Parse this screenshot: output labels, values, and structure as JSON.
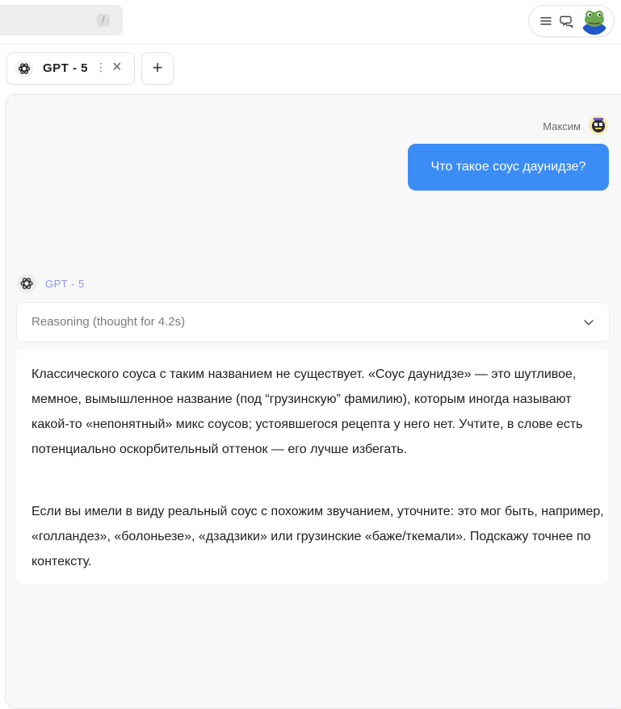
{
  "search": {
    "shortcut": "/"
  },
  "tab": {
    "title": "GPT - 5",
    "more": "⋮",
    "close": "×"
  },
  "add_tab": "+",
  "user": {
    "name": "Максим",
    "message": "Что такое соус даунидзе?"
  },
  "bot": {
    "name": "GPT - 5",
    "reasoning_label": "Reasoning (thought for 4.2s)",
    "paragraphs": [
      "Классического соуса с таким названием не существует. «Соус даунидзе» — это шутливое, мемное, вымышленное название (под “грузинскую” фамилию), которым иногда называют какой-то «непонятный» микс соусов; устоявшегося рецепта у него нет. Учтите, в слове есть потенциально оскорбительный оттенок — его лучше избегать.",
      "Если вы имели в виду реальный соус с похожим звучанием, уточните: это мог быть, например, «голландез», «болоньезе», «дзадзики» или грузинские «баже/ткемали». Подскажу точнее по контексту."
    ]
  },
  "colors": {
    "accent": "#3b8cf5",
    "bot_name": "#8f95e8",
    "panel_bg": "#f8f8f9"
  },
  "icons": [
    "menu-icon",
    "chat-icon",
    "gpt-logo-icon",
    "close-icon",
    "plus-icon",
    "chevron-down-icon"
  ]
}
